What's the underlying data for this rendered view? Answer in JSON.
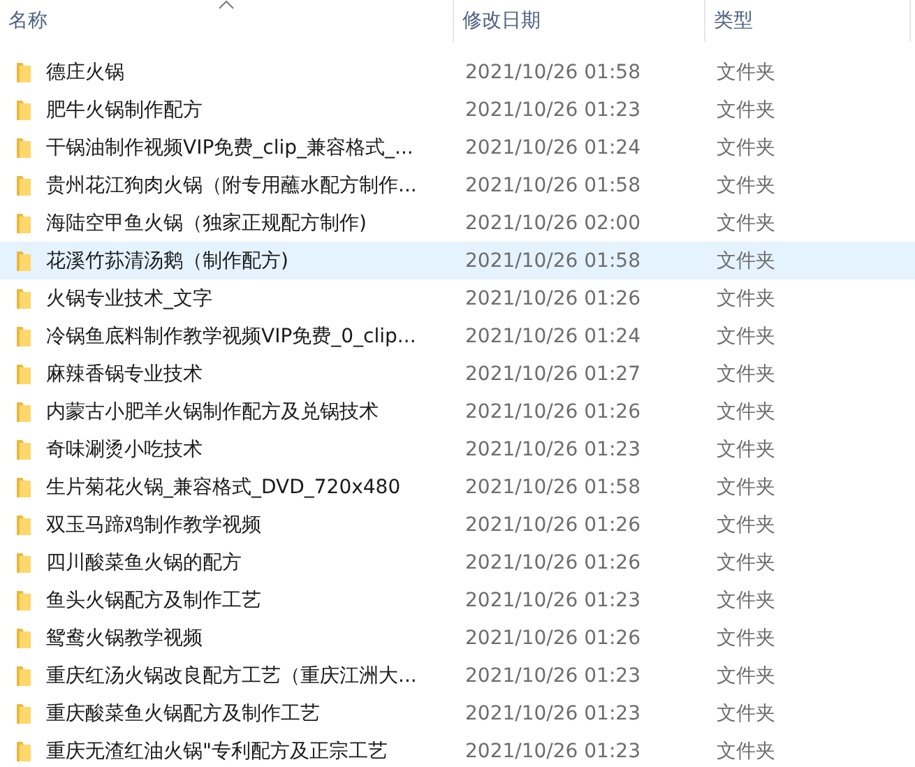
{
  "columns": [
    {
      "label": "名称",
      "sorted": true
    },
    {
      "label": "修改日期",
      "sorted": false
    },
    {
      "label": "类型",
      "sorted": false
    }
  ],
  "rows": [
    {
      "name": "德庄火锅",
      "date": "2021/10/26 01:58",
      "type": "文件夹",
      "selected": false
    },
    {
      "name": "肥牛火锅制作配方",
      "date": "2021/10/26 01:23",
      "type": "文件夹",
      "selected": false
    },
    {
      "name": "干锅油制作视频VIP免费_clip_兼容格式_...",
      "date": "2021/10/26 01:24",
      "type": "文件夹",
      "selected": false
    },
    {
      "name": "贵州花江狗肉火锅（附专用蘸水配方制作...",
      "date": "2021/10/26 01:58",
      "type": "文件夹",
      "selected": false
    },
    {
      "name": "海陆空甲鱼火锅（独家正规配方制作)",
      "date": "2021/10/26 02:00",
      "type": "文件夹",
      "selected": false
    },
    {
      "name": "花溪竹荪清汤鹅（制作配方)",
      "date": "2021/10/26 01:58",
      "type": "文件夹",
      "selected": true
    },
    {
      "name": "火锅专业技术_文字",
      "date": "2021/10/26 01:26",
      "type": "文件夹",
      "selected": false
    },
    {
      "name": "冷锅鱼底料制作教学视频VIP免费_0_clip...",
      "date": "2021/10/26 01:24",
      "type": "文件夹",
      "selected": false
    },
    {
      "name": "麻辣香锅专业技术",
      "date": "2021/10/26 01:27",
      "type": "文件夹",
      "selected": false
    },
    {
      "name": "内蒙古小肥羊火锅制作配方及兑锅技术",
      "date": "2021/10/26 01:26",
      "type": "文件夹",
      "selected": false
    },
    {
      "name": "奇味涮烫小吃技术",
      "date": "2021/10/26 01:23",
      "type": "文件夹",
      "selected": false
    },
    {
      "name": "生片菊花火锅_兼容格式_DVD_720x480",
      "date": "2021/10/26 01:58",
      "type": "文件夹",
      "selected": false
    },
    {
      "name": "双玉马蹄鸡制作教学视频",
      "date": "2021/10/26 01:26",
      "type": "文件夹",
      "selected": false
    },
    {
      "name": "四川酸菜鱼火锅的配方",
      "date": "2021/10/26 01:26",
      "type": "文件夹",
      "selected": false
    },
    {
      "name": "鱼头火锅配方及制作工艺",
      "date": "2021/10/26 01:23",
      "type": "文件夹",
      "selected": false
    },
    {
      "name": "鸳鸯火锅教学视频",
      "date": "2021/10/26 01:26",
      "type": "文件夹",
      "selected": false
    },
    {
      "name": "重庆红汤火锅改良配方工艺（重庆江洲大...",
      "date": "2021/10/26 01:23",
      "type": "文件夹",
      "selected": false
    },
    {
      "name": "重庆酸菜鱼火锅配方及制作工艺",
      "date": "2021/10/26 01:23",
      "type": "文件夹",
      "selected": false
    },
    {
      "name": "重庆无渣红油火锅\"专利配方及正宗工艺",
      "date": "2021/10/26 01:23",
      "type": "文件夹",
      "selected": false
    }
  ]
}
